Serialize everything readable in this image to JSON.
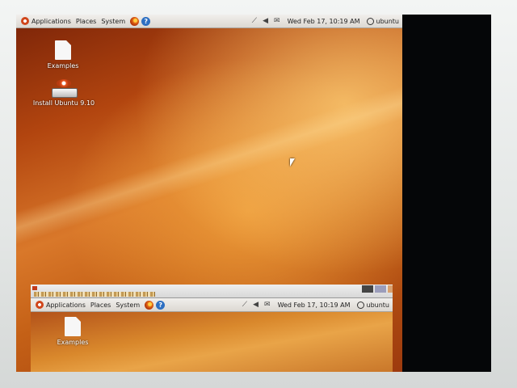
{
  "panel": {
    "applications": "Applications",
    "places": "Places",
    "system": "System",
    "clock": "Wed Feb 17, 10:19 AM",
    "user": "ubuntu",
    "icons": [
      "ubuntu-logo-icon",
      "firefox-icon",
      "help-icon",
      "network-icon",
      "volume-icon",
      "mail-icon",
      "power-icon"
    ]
  },
  "desktop_icons": [
    {
      "label": "Examples",
      "icon": "document-icon"
    },
    {
      "label": "Install Ubuntu 9.10",
      "icon": "installer-drive-icon"
    }
  ],
  "nested": {
    "applications": "Applications",
    "places": "Places",
    "system": "System",
    "clock": "Wed Feb 17, 10:19 AM",
    "user": "ubuntu",
    "examples": "Examples"
  },
  "colors": {
    "accent": "#d9782a",
    "panel": "#e8e5e0",
    "screen_black": "#050608"
  }
}
